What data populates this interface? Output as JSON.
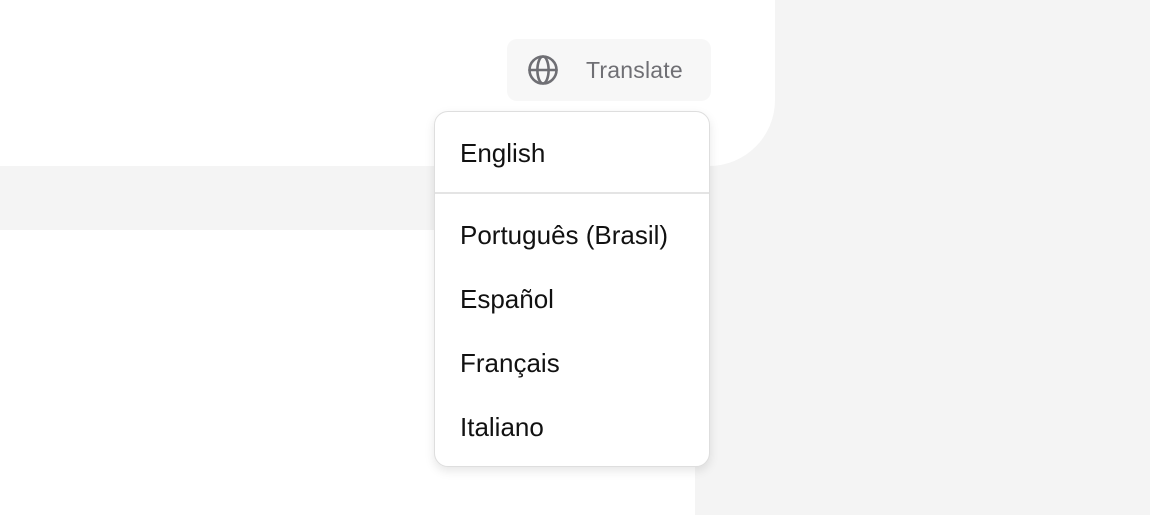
{
  "translate": {
    "label": "Translate",
    "icon": "globe-icon"
  },
  "languages": {
    "current": "English",
    "options": [
      "Português (Brasil)",
      "Español",
      "Français",
      "Italiano"
    ]
  },
  "colors": {
    "page_background": "#f4f4f4",
    "surface": "#ffffff",
    "button_background": "#f7f7f7",
    "muted_text": "#6f6f74",
    "text": "#111111",
    "border": "#dedede"
  }
}
